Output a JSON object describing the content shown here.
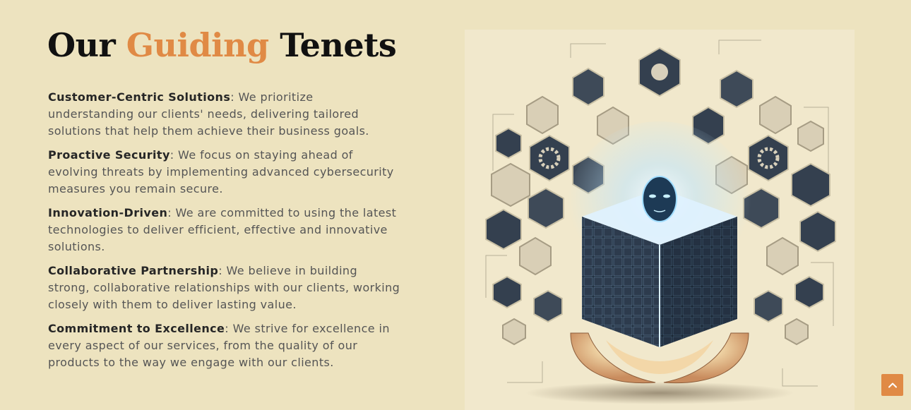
{
  "heading": {
    "prefix": "Our ",
    "accent": "Guiding",
    "suffix": " Tenets",
    "accent_color": "#e08a45"
  },
  "tenets": [
    {
      "title": "Customer-Centric Solutions",
      "text": ": We prioritize understanding our clients' needs, delivering tailored solutions that help them achieve their business goals."
    },
    {
      "title": "Proactive Security",
      "text": ": We focus on staying ahead of evolving threats by implementing advanced cybersecurity measures you remain secure."
    },
    {
      "title": "Innovation-Driven",
      "text": ": We are committed to using the latest technologies to deliver efficient, effective and innovative solutions."
    },
    {
      "title": "Collaborative Partnership",
      "text": ": We believe in building strong, collaborative relationships with our clients, working closely with them to deliver lasting value."
    },
    {
      "title": "Commitment to Excellence",
      "text": ": We strive for excellence in every aspect of our services, from the quality of our products to the way we engage with our clients."
    }
  ],
  "scroll_top": {
    "icon": "chevron-up-icon"
  },
  "colors": {
    "page_background": "#ede3bf",
    "accent": "#e08a45",
    "hex_dark": "#34404f"
  }
}
